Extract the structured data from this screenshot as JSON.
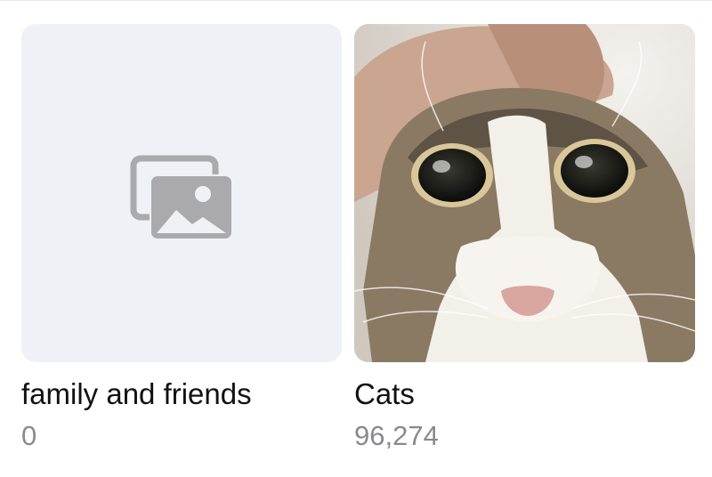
{
  "albums": [
    {
      "name": "family and friends",
      "count": "0",
      "thumbnail": "empty-placeholder",
      "icon": "photo-stack-icon"
    },
    {
      "name": "Cats",
      "count": "96,274",
      "thumbnail": "cat-photo"
    }
  ],
  "colors": {
    "placeholder_bg": "#f0f1f6",
    "placeholder_icon": "#a9a9ae",
    "title": "#111111",
    "count": "#8a8a8e"
  }
}
